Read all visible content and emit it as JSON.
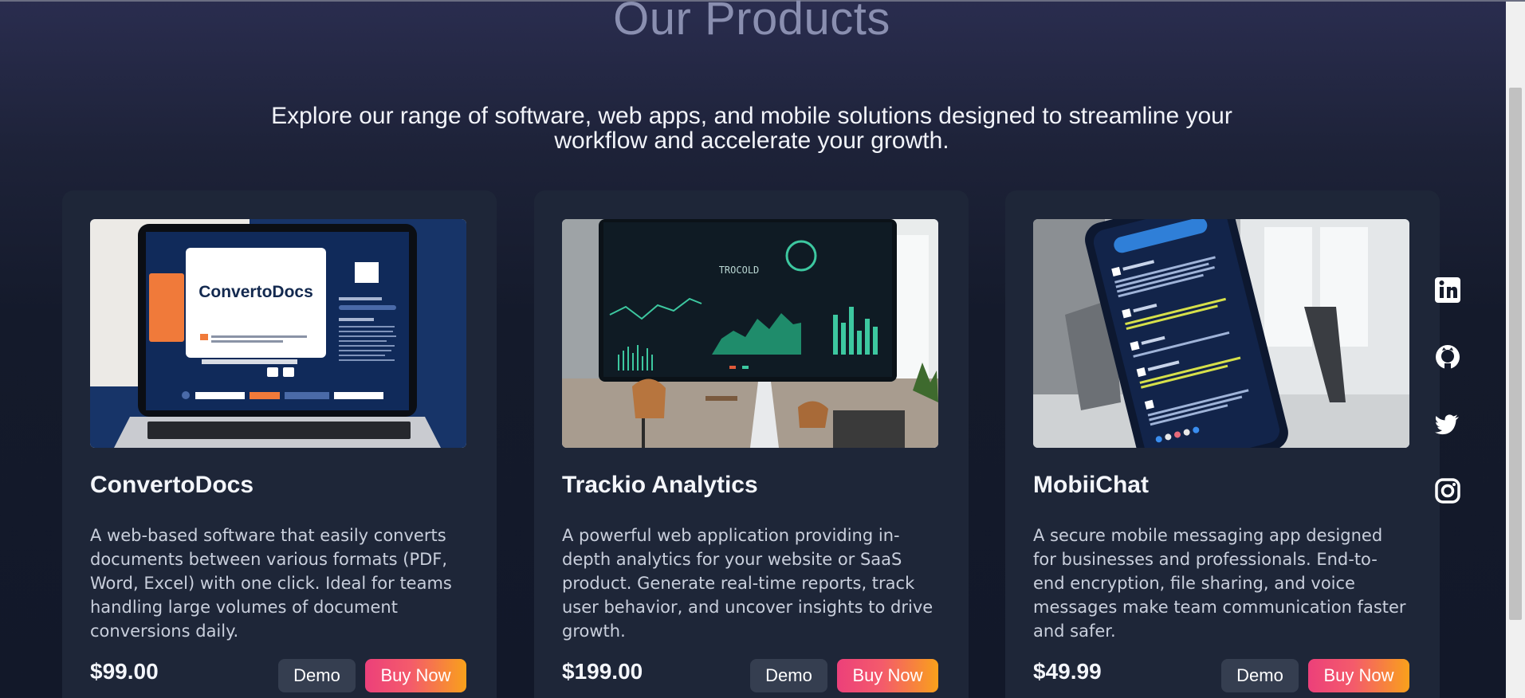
{
  "section": {
    "title": "Our Products",
    "subtitle": "Explore our range of software, web apps, and mobile solutions designed to streamline your workflow and accelerate your growth."
  },
  "products": [
    {
      "name": "ConvertoDocs",
      "description": "A web-based software that easily converts documents between various formats (PDF, Word, Excel) with one click. Ideal for teams handling large volumes of document conversions daily.",
      "price": "$99.00",
      "demo_label": "Demo",
      "buy_label": "Buy Now",
      "image": {
        "screen_logo": "ConvertoDocs"
      }
    },
    {
      "name": "Trackio Analytics",
      "description": "A powerful web application providing in-depth analytics for your website or SaaS product. Generate real-time reports, track user behavior, and uncover insights to drive growth.",
      "price": "$199.00",
      "demo_label": "Demo",
      "buy_label": "Buy Now"
    },
    {
      "name": "MobiiChat",
      "description": "A secure mobile messaging app designed for businesses and professionals. End-to-end encryption, file sharing, and voice messages make team communication faster and safer.",
      "price": "$49.99",
      "demo_label": "Demo",
      "buy_label": "Buy Now"
    }
  ],
  "social": [
    "linkedin-icon",
    "github-icon",
    "twitter-icon",
    "instagram-icon"
  ],
  "colors": {
    "background": "#141a2b",
    "card": "#1e2638",
    "demo_button": "#353e50",
    "buy_gradient_start": "#ec407a",
    "buy_gradient_end": "#f9a11b"
  }
}
